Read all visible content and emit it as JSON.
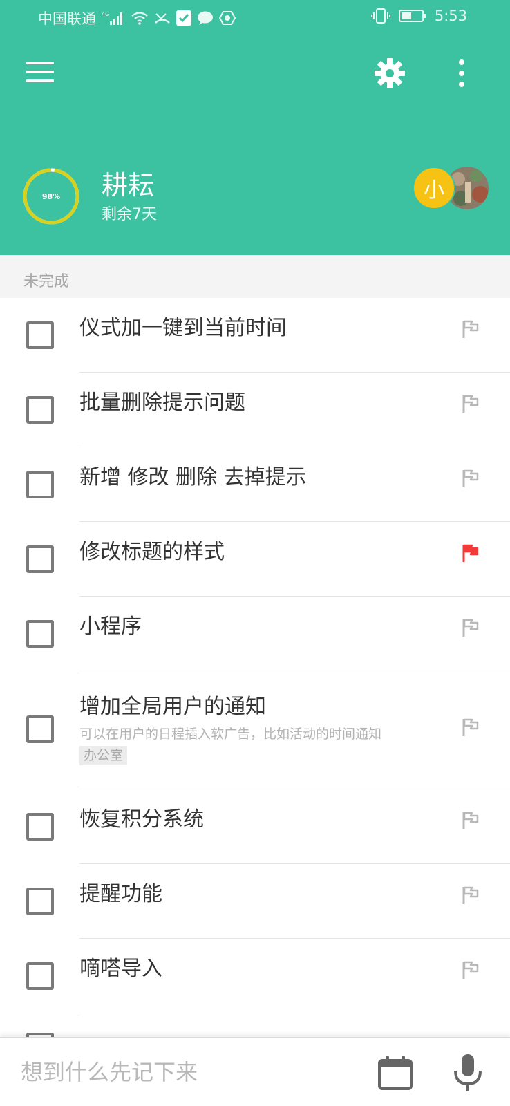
{
  "status_bar": {
    "carrier": "中国联通",
    "network": "4G",
    "time": "5:53",
    "icons": [
      "signal-icon",
      "wifi-icon",
      "missed-call-icon",
      "check-icon",
      "chat-icon",
      "shield-icon",
      "vibrate-icon",
      "battery-icon"
    ]
  },
  "theme": {
    "primary": "#3cc1a1",
    "progress_ring": "#d9d11f",
    "avatar_initial_bg": "#f6c214",
    "flag_active": "#f23a3a",
    "flag_inactive": "#b8b8b8"
  },
  "toolbar": {
    "menu_icon": "hamburger-menu-icon",
    "settings_icon": "gear-icon",
    "more_icon": "more-vertical-icon"
  },
  "project": {
    "progress_label": "98%",
    "progress_fraction": 0.98,
    "title": "耕耘",
    "remaining": "剩余7天",
    "avatar_initial": "小"
  },
  "section": {
    "title": "未完成"
  },
  "tasks": [
    {
      "title": "仪式加一键到当前时间",
      "flagged": false
    },
    {
      "title": "批量删除提示问题",
      "flagged": false
    },
    {
      "title": "新增 修改 删除 去掉提示",
      "flagged": false
    },
    {
      "title": "修改标题的样式",
      "flagged": true
    },
    {
      "title": "小程序",
      "flagged": false
    },
    {
      "title": "增加全局用户的通知",
      "note": "可以在用户的日程插入软广告，比如活动的时间通知",
      "tag": "办公室",
      "flagged": false
    },
    {
      "title": "恢复积分系统",
      "flagged": false
    },
    {
      "title": "提醒功能",
      "flagged": false
    },
    {
      "title": "嘀嗒导入",
      "flagged": false
    }
  ],
  "quick_add": {
    "placeholder": "想到什么先记下来",
    "calendar_icon": "calendar-icon",
    "mic_icon": "microphone-icon"
  }
}
